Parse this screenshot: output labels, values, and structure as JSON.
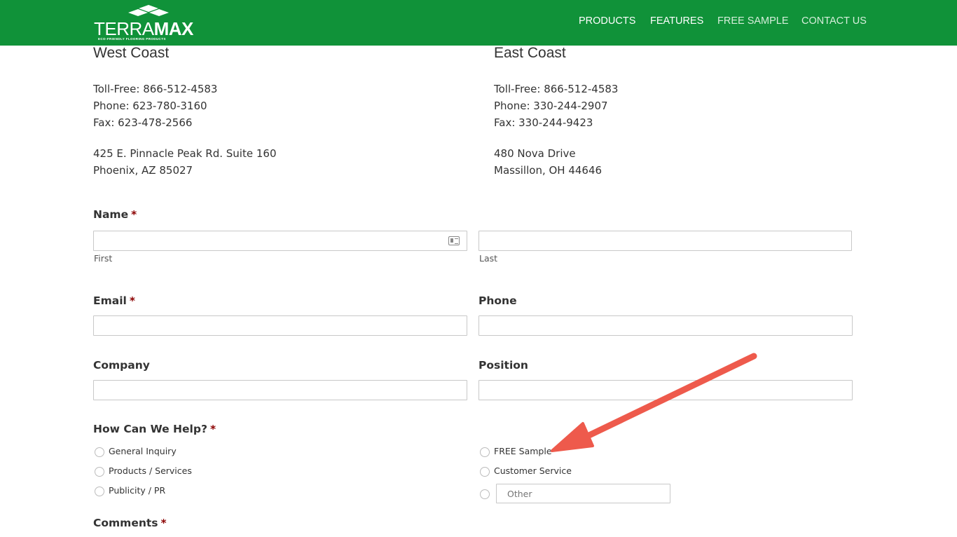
{
  "brand": {
    "name_bold": "TERRA",
    "name_heavy": "MAX",
    "tagline": "ECO-FRIENDLY FLOORING PRODUCTS",
    "color": "#109239"
  },
  "nav": {
    "items": [
      {
        "label": "PRODUCTS"
      },
      {
        "label": "FEATURES"
      },
      {
        "label": "FREE SAMPLE"
      },
      {
        "label": "CONTACT US"
      }
    ]
  },
  "offices": {
    "west": {
      "title": "West Coast",
      "toll_free": "Toll-Free: 866-512-4583",
      "phone": "Phone: 623-780-3160",
      "fax": "Fax: 623-478-2566",
      "address1": "425 E. Pinnacle Peak Rd. Suite 160",
      "address2": "Phoenix, AZ 85027"
    },
    "east": {
      "title": "East Coast",
      "toll_free": "Toll-Free: 866-512-4583",
      "phone": "Phone: 330-244-2907",
      "fax": "Fax: 330-244-9423",
      "address1": "480 Nova Drive",
      "address2": "Massillon, OH 44646"
    }
  },
  "form": {
    "required_marker": "*",
    "name": {
      "label": "Name",
      "first_sublabel": "First",
      "last_sublabel": "Last",
      "first_value": "",
      "last_value": ""
    },
    "email": {
      "label": "Email",
      "value": ""
    },
    "phone": {
      "label": "Phone",
      "value": ""
    },
    "company": {
      "label": "Company",
      "value": ""
    },
    "position": {
      "label": "Position",
      "value": ""
    },
    "help": {
      "label": "How Can We Help?",
      "options_left": [
        "General Inquiry",
        "Products / Services",
        "Publicity / PR"
      ],
      "options_right": [
        "FREE Sample",
        "Customer Service"
      ],
      "other_placeholder": "Other"
    },
    "comments": {
      "label": "Comments"
    }
  },
  "annotation": {
    "arrow_color": "#ee5a4c"
  }
}
